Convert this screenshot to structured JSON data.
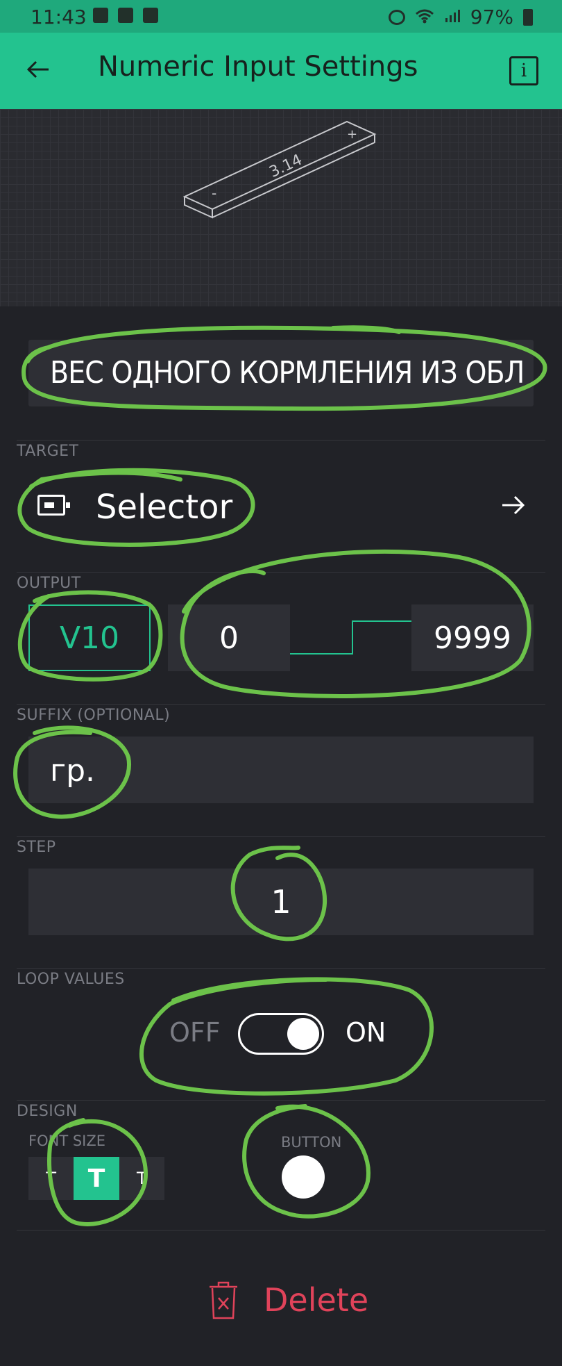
{
  "status_bar": {
    "time": "11:43",
    "battery": "97%"
  },
  "app_bar": {
    "title": "Numeric Input Settings",
    "info": "i"
  },
  "preview": {
    "value": "3.14",
    "minus": "-",
    "plus": "+"
  },
  "name": {
    "value": "ВЕС ОДНОГО КОРМЛЕНИЯ ИЗ ОБЛ"
  },
  "target": {
    "label": "TARGET",
    "value": "Selector"
  },
  "output": {
    "label": "OUTPUT",
    "pin": "V10",
    "min": "0",
    "max": "9999"
  },
  "suffix": {
    "label": "SUFFIX (OPTIONAL)",
    "value": "гр."
  },
  "step": {
    "label": "STEP",
    "value": "1"
  },
  "loop": {
    "label": "LOOP VALUES",
    "off": "OFF",
    "on": "ON",
    "enabled": true
  },
  "design": {
    "label": "DESIGN",
    "font_size_label": "FONT SIZE",
    "font_sizes": [
      "T",
      "T",
      "T"
    ],
    "selected_font_size": 1,
    "button_label": "BUTTON",
    "button_color": "#ffffff"
  },
  "delete": {
    "label": "Delete"
  },
  "colors": {
    "accent": "#23c38f",
    "danger": "#e0435a",
    "annotation": "#6cc24a"
  }
}
